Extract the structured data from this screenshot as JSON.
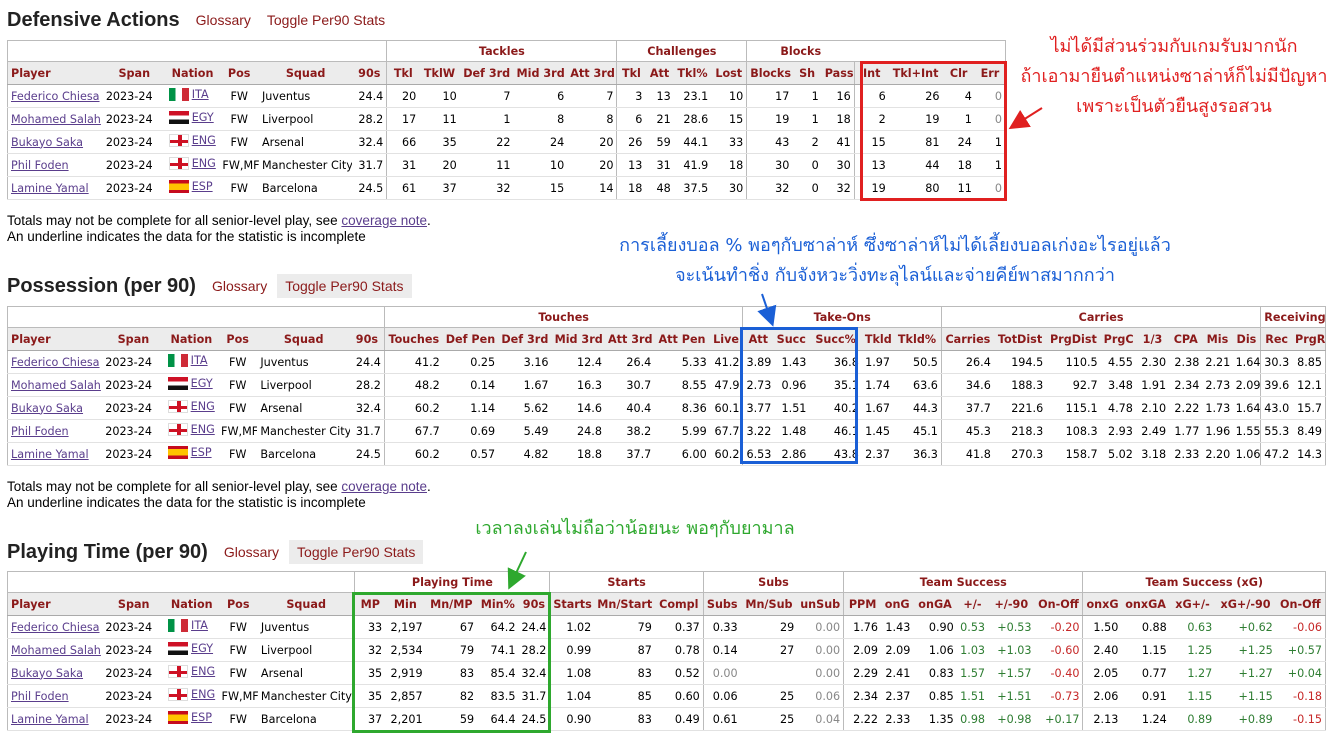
{
  "common": {
    "glossary_label": "Glossary",
    "toggle_label": "Toggle Per90 Stats",
    "note_line1_prefix": "Totals may not be complete for all senior-level play, see ",
    "note_link": "coverage note",
    "note_line1_suffix": ".",
    "note_line2": "An underline indicates the data for the statistic is incomplete"
  },
  "players": [
    {
      "name": "Federico Chiesa",
      "season": "2023-24",
      "flag": "ita",
      "nation": "ITA",
      "pos": "FW",
      "squad": "Juventus"
    },
    {
      "name": "Mohamed Salah",
      "season": "2023-24",
      "flag": "egy",
      "nation": "EGY",
      "pos": "FW",
      "squad": "Liverpool"
    },
    {
      "name": "Bukayo Saka",
      "season": "2023-24",
      "flag": "eng",
      "nation": "ENG",
      "pos": "FW",
      "squad": "Arsenal"
    },
    {
      "name": "Phil Foden",
      "season": "2023-24",
      "flag": "eng",
      "nation": "ENG",
      "pos": "FW,MF",
      "squad": "Manchester City"
    },
    {
      "name": "Lamine Yamal",
      "season": "2023-24",
      "flag": "esp",
      "nation": "ESP",
      "pos": "FW",
      "squad": "Barcelona"
    }
  ],
  "defense": {
    "title": "Defensive Actions",
    "groups": [
      {
        "label": "",
        "span": 6
      },
      {
        "label": "Tackles",
        "span": 5
      },
      {
        "label": "Challenges",
        "span": 4
      },
      {
        "label": "Blocks",
        "span": 3
      },
      {
        "label": "",
        "span": 4
      }
    ],
    "columns": [
      "Player",
      "Span",
      "Nation",
      "Pos",
      "Squad",
      "90s",
      "Tkl",
      "TklW",
      "Def 3rd",
      "Mid 3rd",
      "Att 3rd",
      "Tkl",
      "Att",
      "Tkl%",
      "Lost",
      "Blocks",
      "Sh",
      "Pass",
      "Int",
      "Tkl+Int",
      "Clr",
      "Err"
    ],
    "rows": [
      [
        "24.4",
        "20",
        "10",
        "7",
        "6",
        "7",
        "3",
        "13",
        "23.1",
        "10",
        "17",
        "1",
        "16",
        "6",
        "26",
        "4",
        "0"
      ],
      [
        "28.2",
        "17",
        "11",
        "1",
        "8",
        "8",
        "6",
        "21",
        "28.6",
        "15",
        "19",
        "1",
        "18",
        "2",
        "19",
        "1",
        "0"
      ],
      [
        "32.4",
        "66",
        "35",
        "22",
        "24",
        "20",
        "26",
        "59",
        "44.1",
        "33",
        "43",
        "2",
        "41",
        "15",
        "81",
        "24",
        "1"
      ],
      [
        "31.7",
        "31",
        "20",
        "11",
        "10",
        "20",
        "13",
        "31",
        "41.9",
        "18",
        "30",
        "0",
        "30",
        "13",
        "44",
        "18",
        "1"
      ],
      [
        "24.5",
        "61",
        "37",
        "32",
        "15",
        "14",
        "18",
        "48",
        "37.5",
        "30",
        "32",
        "0",
        "32",
        "19",
        "80",
        "11",
        "0"
      ]
    ]
  },
  "possession": {
    "title": "Possession (per 90)",
    "groups": [
      {
        "label": "",
        "span": 6
      },
      {
        "label": "Touches",
        "span": 7
      },
      {
        "label": "Take-Ons",
        "span": 5
      },
      {
        "label": "Carries",
        "span": 8
      },
      {
        "label": "Receiving",
        "span": 2
      }
    ],
    "columns": [
      "Player",
      "Span",
      "Nation",
      "Pos",
      "Squad",
      "90s",
      "Touches",
      "Def Pen",
      "Def 3rd",
      "Mid 3rd",
      "Att 3rd",
      "Att Pen",
      "Live",
      "Att",
      "Succ",
      "Succ%",
      "Tkld",
      "Tkld%",
      "Carries",
      "TotDist",
      "PrgDist",
      "PrgC",
      "1/3",
      "CPA",
      "Mis",
      "Dis",
      "Rec",
      "PrgR"
    ],
    "rows": [
      [
        "24.4",
        "41.2",
        "0.25",
        "3.16",
        "12.4",
        "26.4",
        "5.33",
        "41.2",
        "3.89",
        "1.43",
        "36.8",
        "1.97",
        "50.5",
        "26.4",
        "194.5",
        "110.5",
        "4.55",
        "2.30",
        "2.38",
        "2.21",
        "1.64",
        "30.3",
        "8.85"
      ],
      [
        "28.2",
        "48.2",
        "0.14",
        "1.67",
        "16.3",
        "30.7",
        "8.55",
        "47.9",
        "2.73",
        "0.96",
        "35.1",
        "1.74",
        "63.6",
        "34.6",
        "188.3",
        "92.7",
        "3.48",
        "1.91",
        "2.34",
        "2.73",
        "2.09",
        "39.6",
        "12.1"
      ],
      [
        "32.4",
        "60.2",
        "1.14",
        "5.62",
        "14.6",
        "40.4",
        "8.36",
        "60.1",
        "3.77",
        "1.51",
        "40.2",
        "1.67",
        "44.3",
        "37.7",
        "221.6",
        "115.1",
        "4.78",
        "2.10",
        "2.22",
        "1.73",
        "1.64",
        "43.0",
        "15.7"
      ],
      [
        "31.7",
        "67.7",
        "0.69",
        "5.49",
        "24.8",
        "38.2",
        "5.99",
        "67.7",
        "3.22",
        "1.48",
        "46.1",
        "1.45",
        "45.1",
        "45.3",
        "218.3",
        "108.3",
        "2.93",
        "2.49",
        "1.77",
        "1.96",
        "1.55",
        "55.3",
        "8.49"
      ],
      [
        "24.5",
        "60.2",
        "0.57",
        "4.82",
        "18.8",
        "37.7",
        "6.00",
        "60.2",
        "6.53",
        "2.86",
        "43.8",
        "2.37",
        "36.3",
        "41.8",
        "270.3",
        "158.7",
        "5.02",
        "3.18",
        "2.33",
        "2.20",
        "1.06",
        "47.2",
        "14.3"
      ]
    ]
  },
  "playing": {
    "title": "Playing Time (per 90)",
    "groups": [
      {
        "label": "",
        "span": 5
      },
      {
        "label": "Playing Time",
        "span": 5
      },
      {
        "label": "Starts",
        "span": 3
      },
      {
        "label": "Subs",
        "span": 3
      },
      {
        "label": "Team Success",
        "span": 6
      },
      {
        "label": "Team Success (xG)",
        "span": 5
      }
    ],
    "columns": [
      "Player",
      "Span",
      "Nation",
      "Pos",
      "Squad",
      "MP",
      "Min",
      "Mn/MP",
      "Min%",
      "90s",
      "Starts",
      "Mn/Start",
      "Compl",
      "Subs",
      "Mn/Sub",
      "unSub",
      "PPM",
      "onG",
      "onGA",
      "+/-",
      "+/-90",
      "On-Off",
      "onxG",
      "onxGA",
      "xG+/-",
      "xG+/-90",
      "On-Off"
    ],
    "rows": [
      [
        "33",
        "2,197",
        "67",
        "64.2",
        "24.4",
        "1.02",
        "79",
        "0.37",
        "0.33",
        "29",
        "0.00",
        "1.76",
        "1.43",
        "0.90",
        "0.53",
        "+0.53",
        "-0.20",
        "1.50",
        "0.88",
        "0.63",
        "+0.62",
        "-0.06"
      ],
      [
        "32",
        "2,534",
        "79",
        "74.1",
        "28.2",
        "0.99",
        "87",
        "0.78",
        "0.14",
        "27",
        "0.00",
        "2.09",
        "2.09",
        "1.06",
        "1.03",
        "+1.03",
        "-0.60",
        "2.40",
        "1.15",
        "1.25",
        "+1.25",
        "+0.57"
      ],
      [
        "35",
        "2,919",
        "83",
        "85.4",
        "32.4",
        "1.08",
        "83",
        "0.52",
        "0.00",
        "",
        "0.00",
        "2.29",
        "2.41",
        "0.83",
        "1.57",
        "+1.57",
        "-0.40",
        "2.05",
        "0.77",
        "1.27",
        "+1.27",
        "+0.04"
      ],
      [
        "35",
        "2,857",
        "82",
        "83.5",
        "31.7",
        "1.04",
        "85",
        "0.60",
        "0.06",
        "25",
        "0.06",
        "2.34",
        "2.37",
        "0.85",
        "1.51",
        "+1.51",
        "-0.73",
        "2.06",
        "0.91",
        "1.15",
        "+1.15",
        "-0.18"
      ],
      [
        "37",
        "2,201",
        "59",
        "64.4",
        "24.5",
        "0.90",
        "83",
        "0.49",
        "0.61",
        "25",
        "0.04",
        "2.22",
        "2.33",
        "1.35",
        "0.98",
        "+0.98",
        "+0.17",
        "2.13",
        "1.24",
        "0.89",
        "+0.89",
        "-0.15"
      ]
    ]
  },
  "annotations": {
    "red_line1": "ไม่ได้มีส่วนร่วมกับเกมรับมากนัก",
    "red_line2": "ถ้าเอามายืนตำแหน่งซาล่าห์ก็ไม่มีปัญหา",
    "red_line3": "เพราะเป็นตัวยืนสูงรอสวน",
    "blue_line1": "การเลี้ยงบอล % พอๆกับซาล่าห์ ซึ่งซาล่าห์ไม่ได้เลี้ยงบอลเก่งอะไรอยู่แล้ว",
    "blue_line2": "จะเน้นทำชิ่ง   กับจังหวะวิ่งทะลุไลน์และจ่ายคีย์พาสมากกว่า",
    "green_line1": "เวลาลงเล่นไม่ถือว่าน้อยนะ พอๆกับยามาล",
    "colors": {
      "red": "#e02020",
      "blue": "#1a5fd6",
      "green": "#2ea82e"
    }
  }
}
